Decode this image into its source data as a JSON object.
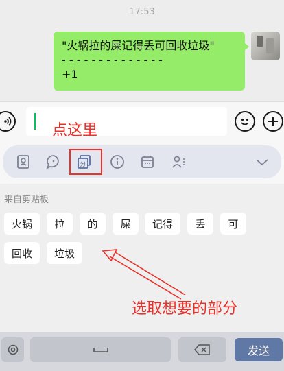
{
  "status": {
    "time": "17:53"
  },
  "message": {
    "line1": "\"火锅拉的屎记得丢可回收垃圾\"",
    "line2": "- - - - - - - - - - - - - -",
    "line3": "+1"
  },
  "input": {
    "value": ""
  },
  "toolbar": {
    "icons": [
      "contact-card-icon",
      "chat-bubble-icon",
      "segment-words-icon",
      "info-icon",
      "calendar-icon",
      "person-list-icon",
      "collapse-triangle-icon"
    ]
  },
  "clipboard": {
    "title": "来自剪贴板",
    "chips": [
      "火锅",
      "拉",
      "的",
      "屎",
      "记得",
      "丢",
      "可",
      "回收",
      "垃圾"
    ]
  },
  "annotations": {
    "click_here": "点这里",
    "pick_parts": "选取想要的部分"
  },
  "keyboard": {
    "send_label": "发送"
  },
  "colors": {
    "bubble": "#95ec69",
    "annotation": "#e8322b",
    "send": "#5f78a5",
    "caret": "#07c160"
  }
}
